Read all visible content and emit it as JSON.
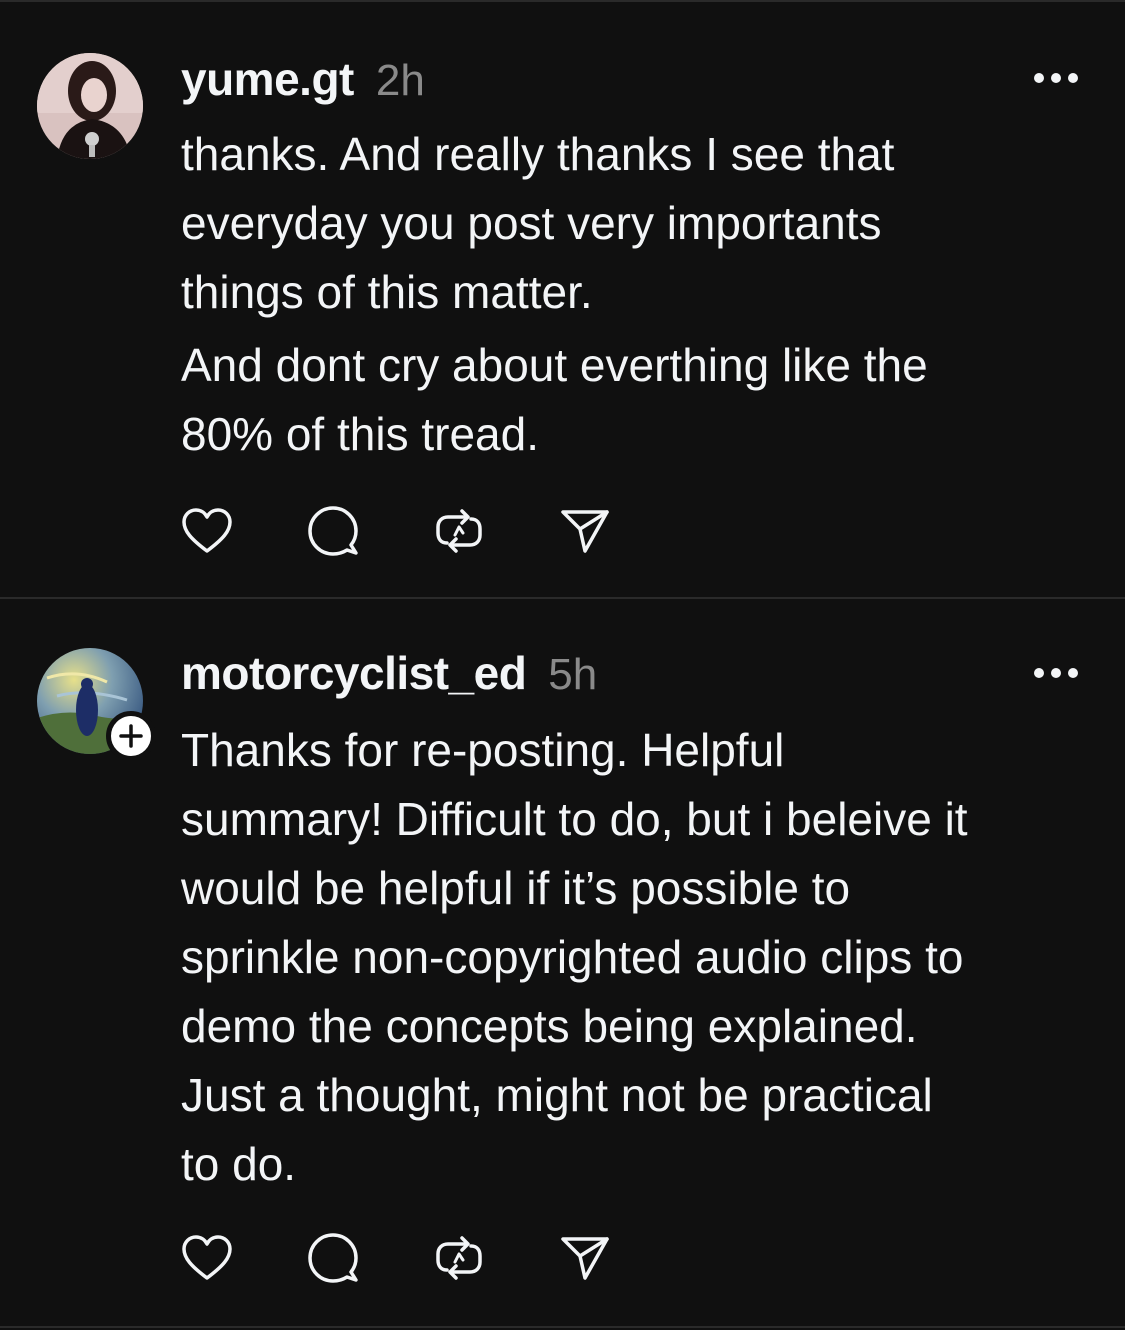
{
  "posts": [
    {
      "username": "yume.gt",
      "time": "2h",
      "paragraphs": [
        [
          "thanks. And really thanks I see that",
          "everyday you post very importants",
          "things of this matter."
        ],
        [
          "And dont cry about everthing like the",
          "80% of this tread."
        ]
      ],
      "avatar_icon": "profile-photo",
      "has_follow_badge": false
    },
    {
      "username": "motorcyclist_ed",
      "time": "5h",
      "paragraphs": [
        [
          "Thanks for re-posting. Helpful",
          "summary! Difficult to do, but i beleive it",
          "would be helpful if it’s possible to",
          "sprinkle non-copyrighted audio clips to",
          "demo the concepts being explained.",
          "Just a thought, might not be practical",
          "to do."
        ]
      ],
      "avatar_icon": "painting-avatar",
      "has_follow_badge": true,
      "follow_badge_icon": "plus-icon"
    }
  ],
  "actions": [
    "heart-icon",
    "comment-icon",
    "repost-icon",
    "share-icon"
  ],
  "colors": {
    "background": "#101010",
    "text": "#f3f5f7",
    "muted": "#8a8a8a",
    "divider": "#2a2a2a"
  }
}
